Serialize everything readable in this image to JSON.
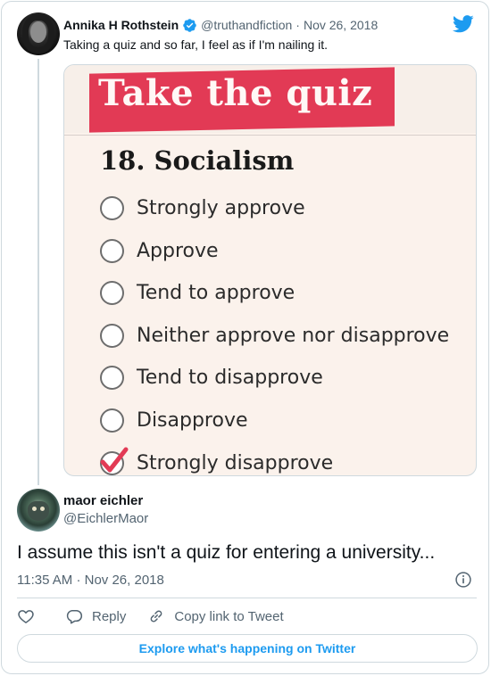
{
  "parent_tweet": {
    "author_name": "Annika H Rothstein",
    "handle": "@truthandfiction",
    "separator": "·",
    "date": "Nov 26, 2018",
    "text": "Taking a quiz and so far, I feel as if I'm nailing it.",
    "media": {
      "banner_title": "Take the quiz",
      "question": "18. Socialism",
      "options": [
        {
          "label": "Strongly approve",
          "checked": false
        },
        {
          "label": "Approve",
          "checked": false
        },
        {
          "label": "Tend to approve",
          "checked": false
        },
        {
          "label": "Neither approve nor disapprove",
          "checked": false
        },
        {
          "label": "Tend to disapprove",
          "checked": false
        },
        {
          "label": "Disapprove",
          "checked": false
        },
        {
          "label": "Strongly disapprove",
          "checked": true
        }
      ],
      "banner_color": "#e23a55",
      "check_color": "#e23a55"
    }
  },
  "reply_tweet": {
    "author_name": "maor eichler",
    "handle": "@EichlerMaor",
    "text": "I assume this isn't a quiz for entering a university...",
    "time": "11:35 AM",
    "separator": "·",
    "date": "Nov 26, 2018"
  },
  "actions": {
    "like_icon": "heart-icon",
    "reply_label": "Reply",
    "copy_link_label": "Copy link to Tweet"
  },
  "explore_label": "Explore what's happening on Twitter",
  "colors": {
    "twitter_blue": "#1d9bf0",
    "secondary_text": "#536471",
    "border": "#cfd9de"
  }
}
